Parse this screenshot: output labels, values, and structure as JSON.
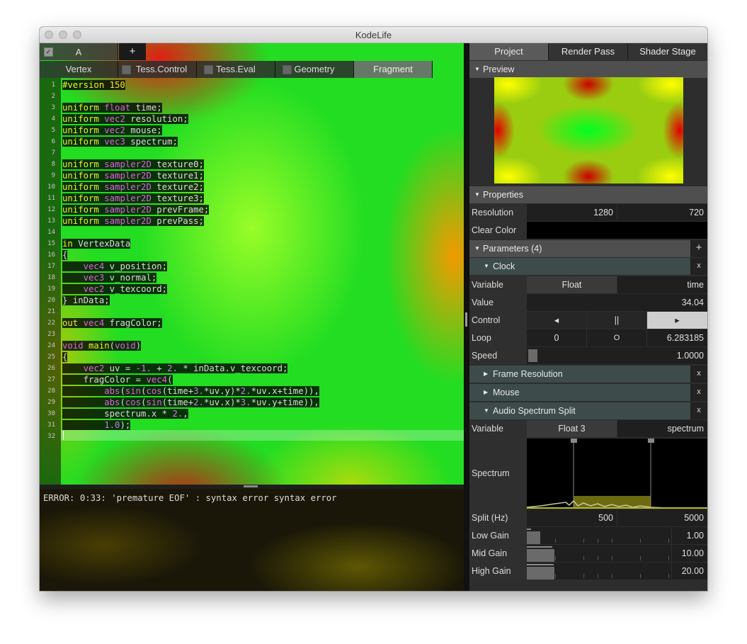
{
  "window": {
    "title": "KodeLife"
  },
  "doc_tabs": {
    "active": "A",
    "add_label": "+"
  },
  "stage_tabs": [
    "Vertex",
    "Tess.Control",
    "Tess.Eval",
    "Geometry",
    "Fragment"
  ],
  "code_lines": [
    [
      [
        "kw",
        "#version 150"
      ]
    ],
    [],
    [
      [
        "kw",
        "uniform "
      ],
      [
        "ty",
        "float"
      ],
      [
        "tx",
        " time"
      ],
      [
        "tx",
        ";"
      ]
    ],
    [
      [
        "kw",
        "uniform "
      ],
      [
        "ty",
        "vec2"
      ],
      [
        "tx",
        " resolution"
      ],
      [
        "tx",
        ";"
      ]
    ],
    [
      [
        "kw",
        "uniform "
      ],
      [
        "ty",
        "vec2"
      ],
      [
        "tx",
        " mouse"
      ],
      [
        "tx",
        ";"
      ]
    ],
    [
      [
        "kw",
        "uniform "
      ],
      [
        "ty",
        "vec3"
      ],
      [
        "tx",
        " spectrum"
      ],
      [
        "tx",
        ";"
      ]
    ],
    [],
    [
      [
        "kw",
        "uniform "
      ],
      [
        "ty",
        "sampler2D"
      ],
      [
        "tx",
        " texture0"
      ],
      [
        "tx",
        ";"
      ]
    ],
    [
      [
        "kw",
        "uniform "
      ],
      [
        "ty",
        "sampler2D"
      ],
      [
        "tx",
        " texture1"
      ],
      [
        "tx",
        ";"
      ]
    ],
    [
      [
        "kw",
        "uniform "
      ],
      [
        "ty",
        "sampler2D"
      ],
      [
        "tx",
        " texture2"
      ],
      [
        "tx",
        ";"
      ]
    ],
    [
      [
        "kw",
        "uniform "
      ],
      [
        "ty",
        "sampler2D"
      ],
      [
        "tx",
        " texture3"
      ],
      [
        "tx",
        ";"
      ]
    ],
    [
      [
        "kw",
        "uniform "
      ],
      [
        "ty",
        "sampler2D"
      ],
      [
        "tx",
        " prevFrame"
      ],
      [
        "tx",
        ";"
      ]
    ],
    [
      [
        "kw",
        "uniform "
      ],
      [
        "ty",
        "sampler2D"
      ],
      [
        "tx",
        " prevPass"
      ],
      [
        "tx",
        ";"
      ]
    ],
    [],
    [
      [
        "kw",
        "in"
      ],
      [
        "tx",
        " VertexData"
      ]
    ],
    [
      [
        "tx",
        "{"
      ]
    ],
    [
      [
        "tx",
        "    "
      ],
      [
        "ty",
        "vec4"
      ],
      [
        "tx",
        " v_position;"
      ]
    ],
    [
      [
        "tx",
        "    "
      ],
      [
        "ty",
        "vec3"
      ],
      [
        "tx",
        " v_normal;"
      ]
    ],
    [
      [
        "tx",
        "    "
      ],
      [
        "ty",
        "vec2"
      ],
      [
        "tx",
        " v_texcoord;"
      ]
    ],
    [
      [
        "tx",
        "} inData;"
      ]
    ],
    [],
    [
      [
        "kw",
        "out "
      ],
      [
        "ty",
        "vec4"
      ],
      [
        "tx",
        " fragColor;"
      ]
    ],
    [],
    [
      [
        "ty",
        "void"
      ],
      [
        "kw",
        " main"
      ],
      [
        "tx",
        "("
      ],
      [
        "ty",
        "void"
      ],
      [
        "tx",
        ")"
      ]
    ],
    [
      [
        "tx",
        "{"
      ]
    ],
    [
      [
        "tx",
        "    "
      ],
      [
        "ty",
        "vec2"
      ],
      [
        "tx",
        " uv = "
      ],
      [
        "nm",
        "-1."
      ],
      [
        "tx",
        " + "
      ],
      [
        "nm",
        "2."
      ],
      [
        "tx",
        " * inData.v_texcoord;"
      ]
    ],
    [
      [
        "tx",
        "    fragColor = "
      ],
      [
        "ty",
        "vec4"
      ],
      [
        "tx",
        "("
      ]
    ],
    [
      [
        "tx",
        "        "
      ],
      [
        "ty",
        "abs"
      ],
      [
        "tx",
        "("
      ],
      [
        "ty",
        "sin"
      ],
      [
        "tx",
        "("
      ],
      [
        "ty",
        "cos"
      ],
      [
        "tx",
        "(time+"
      ],
      [
        "nm",
        "3."
      ],
      [
        "tx",
        "*uv.y)*"
      ],
      [
        "nm",
        "2."
      ],
      [
        "tx",
        "*uv.x+time)),"
      ]
    ],
    [
      [
        "tx",
        "        "
      ],
      [
        "ty",
        "abs"
      ],
      [
        "tx",
        "("
      ],
      [
        "ty",
        "cos"
      ],
      [
        "tx",
        "("
      ],
      [
        "ty",
        "sin"
      ],
      [
        "tx",
        "(time+"
      ],
      [
        "nm",
        "2."
      ],
      [
        "tx",
        "*uv.x)*"
      ],
      [
        "nm",
        "3."
      ],
      [
        "tx",
        "*uv.y+time)),"
      ]
    ],
    [
      [
        "tx",
        "        spectrum.x * "
      ],
      [
        "nm",
        "2."
      ],
      [
        "tx",
        ","
      ]
    ],
    [
      [
        "tx",
        "        "
      ],
      [
        "nm",
        "1.0"
      ],
      [
        "tx",
        ");"
      ]
    ],
    []
  ],
  "error_text": "ERROR: 0:33: 'premature EOF' : syntax error syntax error",
  "right_tabs": [
    "Project",
    "Render Pass",
    "Shader Stage"
  ],
  "preview": {
    "header": "Preview"
  },
  "properties": {
    "header": "Properties",
    "resolution_label": "Resolution",
    "res_w": "1280",
    "res_h": "720",
    "clear_color_label": "Clear Color"
  },
  "parameters": {
    "header": "Parameters (4)",
    "add_label": "+",
    "close_label": "x",
    "clock": {
      "title": "Clock",
      "variable_label": "Variable",
      "type": "Float",
      "name": "time",
      "value_label": "Value",
      "value": "34.04",
      "control_label": "Control",
      "prev": "◂",
      "pause": "||",
      "play": "▸",
      "loop_label": "Loop",
      "loop_start": "0",
      "loop_mid": "O",
      "loop_end": "6.283185",
      "speed_label": "Speed",
      "speed": "1.0000"
    },
    "frame_resolution": {
      "title": "Frame Resolution"
    },
    "mouse": {
      "title": "Mouse"
    },
    "audio": {
      "title": "Audio Spectrum Split",
      "variable_label": "Variable",
      "type": "Float 3",
      "name": "spectrum",
      "spectrum_label": "Spectrum",
      "split_label": "Split (Hz)",
      "split_low": "500",
      "split_high": "5000",
      "low_gain_label": "Low Gain",
      "low_gain": "1.00",
      "mid_gain_label": "Mid Gain",
      "mid_gain": "10.00",
      "high_gain_label": "High Gain",
      "high_gain": "20.00"
    }
  },
  "colors": {
    "keyword": "#f0f030",
    "type": "#e060e0",
    "number": "#cc77ee",
    "text": "#dcdcdc"
  }
}
